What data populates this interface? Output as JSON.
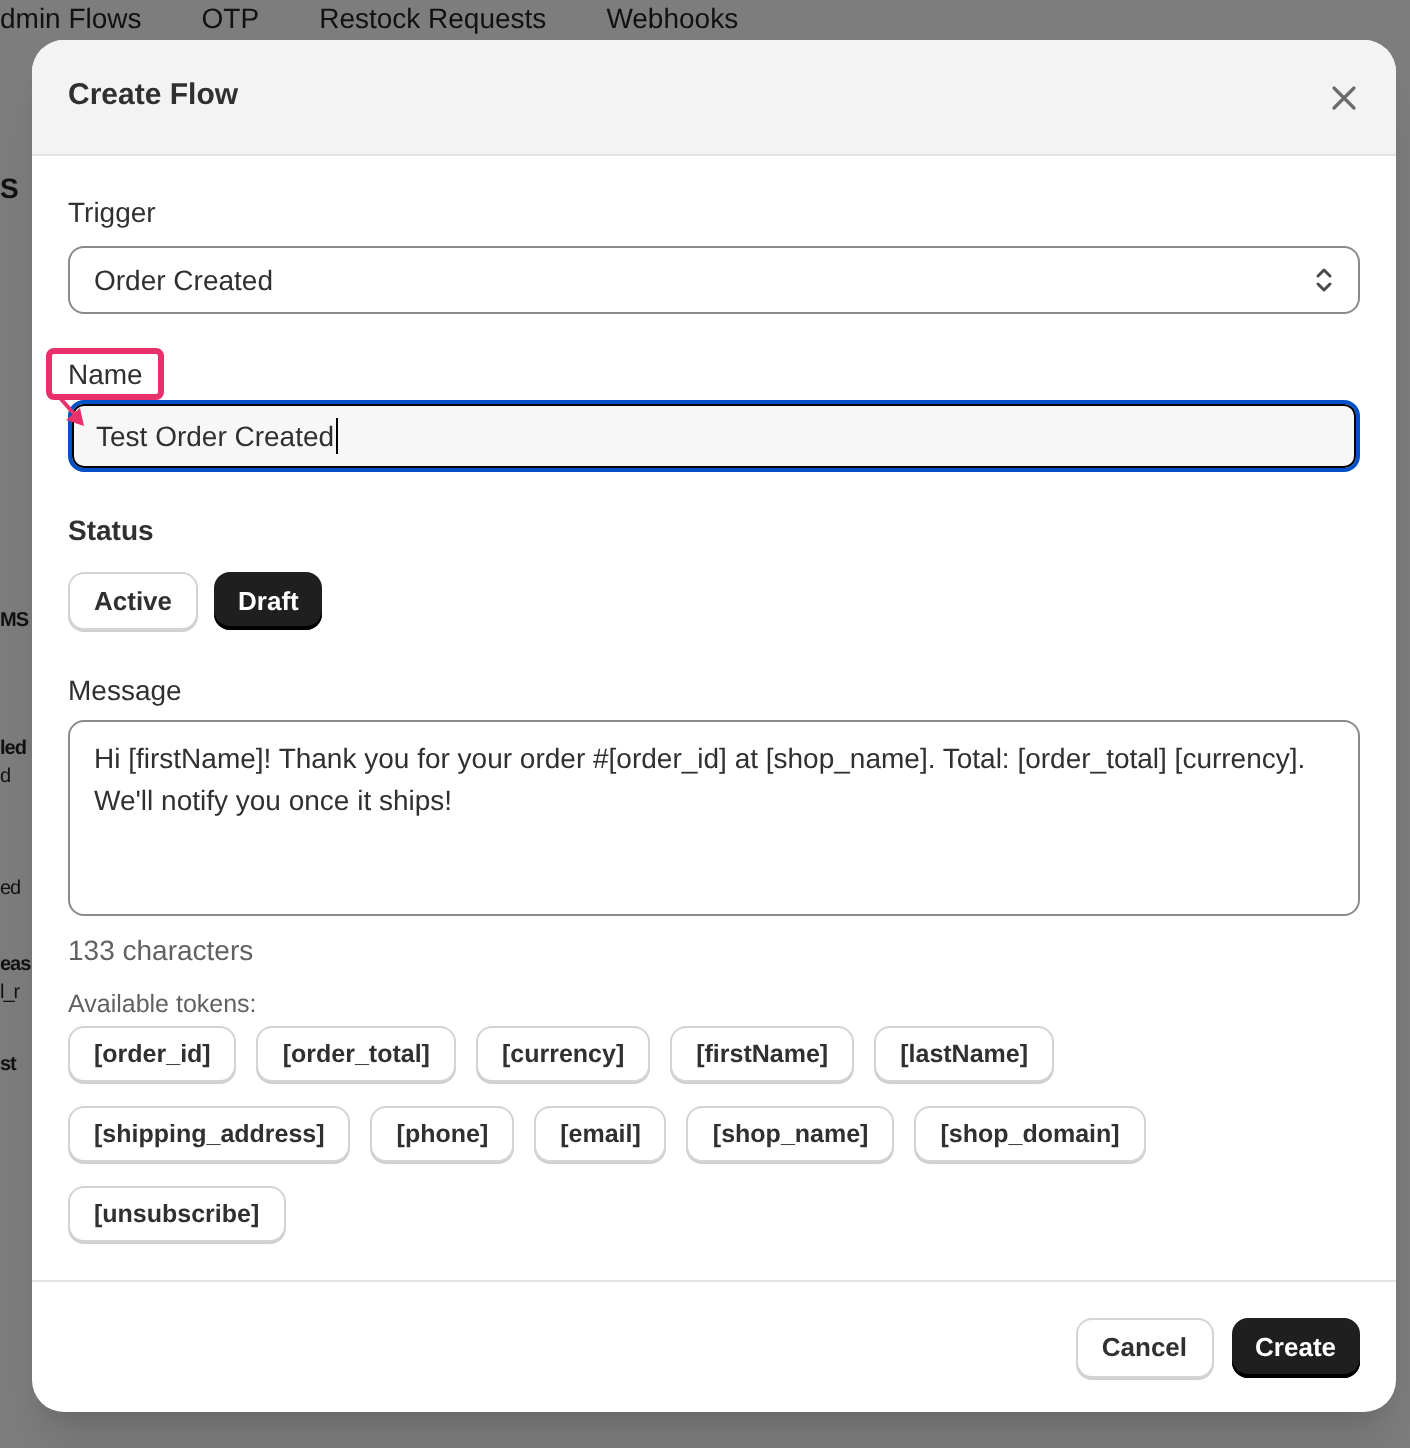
{
  "background": {
    "tabs": [
      "dmin Flows",
      "OTP",
      "Restock Requests",
      "Webhooks"
    ],
    "fragments": [
      {
        "text": "S",
        "bold": true
      },
      {
        "text": "MS",
        "bold": true
      },
      {
        "text": "led",
        "bold": true
      },
      {
        "text": "d",
        "bold": false
      },
      {
        "text": "ed",
        "bold": false
      },
      {
        "text": "eas",
        "bold": true
      },
      {
        "text": "l_r",
        "bold": false
      },
      {
        "text": "st",
        "bold": true
      }
    ]
  },
  "dialog": {
    "title": "Create Flow",
    "trigger": {
      "label": "Trigger",
      "value": "Order Created"
    },
    "name": {
      "label": "Name",
      "value": "Test Order Created",
      "focused": true
    },
    "status": {
      "label": "Status",
      "options": [
        {
          "label": "Active",
          "selected": false
        },
        {
          "label": "Draft",
          "selected": true
        }
      ]
    },
    "message": {
      "label": "Message",
      "value": "Hi [firstName]! Thank you for your order #[order_id] at [shop_name]. Total: [order_total] [currency]. We'll notify you once it ships!",
      "count": "133 characters"
    },
    "tokens_label": "Available tokens:",
    "tokens": [
      "[order_id]",
      "[order_total]",
      "[currency]",
      "[firstName]",
      "[lastName]",
      "[shipping_address]",
      "[phone]",
      "[email]",
      "[shop_name]",
      "[shop_domain]",
      "[unsubscribe]"
    ],
    "buttons": [
      {
        "label": "Cancel",
        "kind": "secondary"
      },
      {
        "label": "Create",
        "kind": "primary"
      }
    ]
  }
}
